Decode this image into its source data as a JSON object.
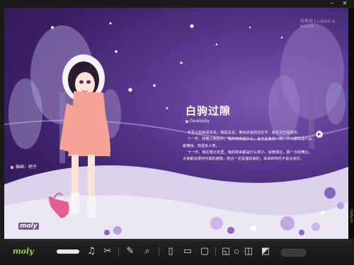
{
  "window": {
    "minimize_glyph": "–",
    "close_glyph": "×"
  },
  "header": {
    "links": "简笔画 | Labels & Badge"
  },
  "article": {
    "title": "白驹过隙",
    "author": "Dewbaby",
    "paragraphs": [
      "    冬至以后就是年关，我是总总，像出诉说的记在半，就在又已是经年。",
      "    十一岁，拼着火色的手，我的将来是什么，会不会象你一样，什么都知道什么都懂得，简便多人笑。",
      "    十一岁，我在笔记本里，我的将来都是什么样子，就像现在，那一次的舞台，大家都会很吵吵真的被挑，结合一定是最初家的，来来的快乐不会太快乐。"
    ]
  },
  "illustration": {
    "caption": "插画：柯子",
    "sticker": "moly"
  },
  "toolbar": {
    "logo": "moly",
    "icons": [
      "music-icon",
      "scissors-icon",
      "paint-icon",
      "zoom-icon",
      "page-single-icon",
      "page-double-icon",
      "page-flip-icon",
      "page-curl-icon",
      "dot-icon",
      "page-corner-icon",
      "page-fold-icon"
    ]
  },
  "side_strip": {
    "label": "moly.cn"
  },
  "colors": {
    "bg_deep": "#2b164f",
    "bg_mid": "#5a3b91",
    "accent_pink": "#ff9bb5",
    "logo_green": "#9bd24a"
  }
}
